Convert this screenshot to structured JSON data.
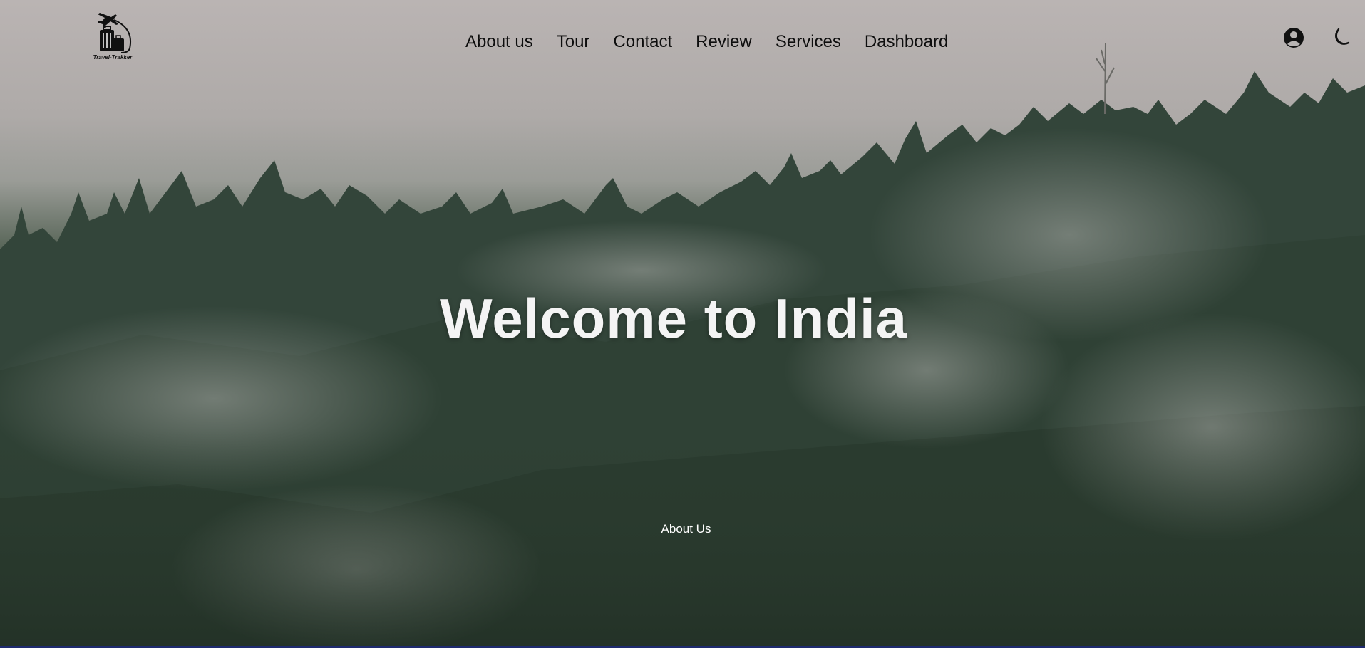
{
  "brand": {
    "logo_text": "Travel-Trakker"
  },
  "nav": {
    "items": [
      {
        "label": "About us"
      },
      {
        "label": "Tour"
      },
      {
        "label": "Contact"
      },
      {
        "label": "Review"
      },
      {
        "label": "Services"
      },
      {
        "label": "Dashboard"
      }
    ]
  },
  "header_icons": {
    "profile": "user-circle-icon",
    "theme": "moon-icon"
  },
  "hero": {
    "title": "Welcome to India",
    "link_label": "About Us"
  },
  "colors": {
    "nav_text": "#0d0d0d",
    "hero_text": "#f4f4f4",
    "bottom_bar": "#1e2a6e"
  }
}
